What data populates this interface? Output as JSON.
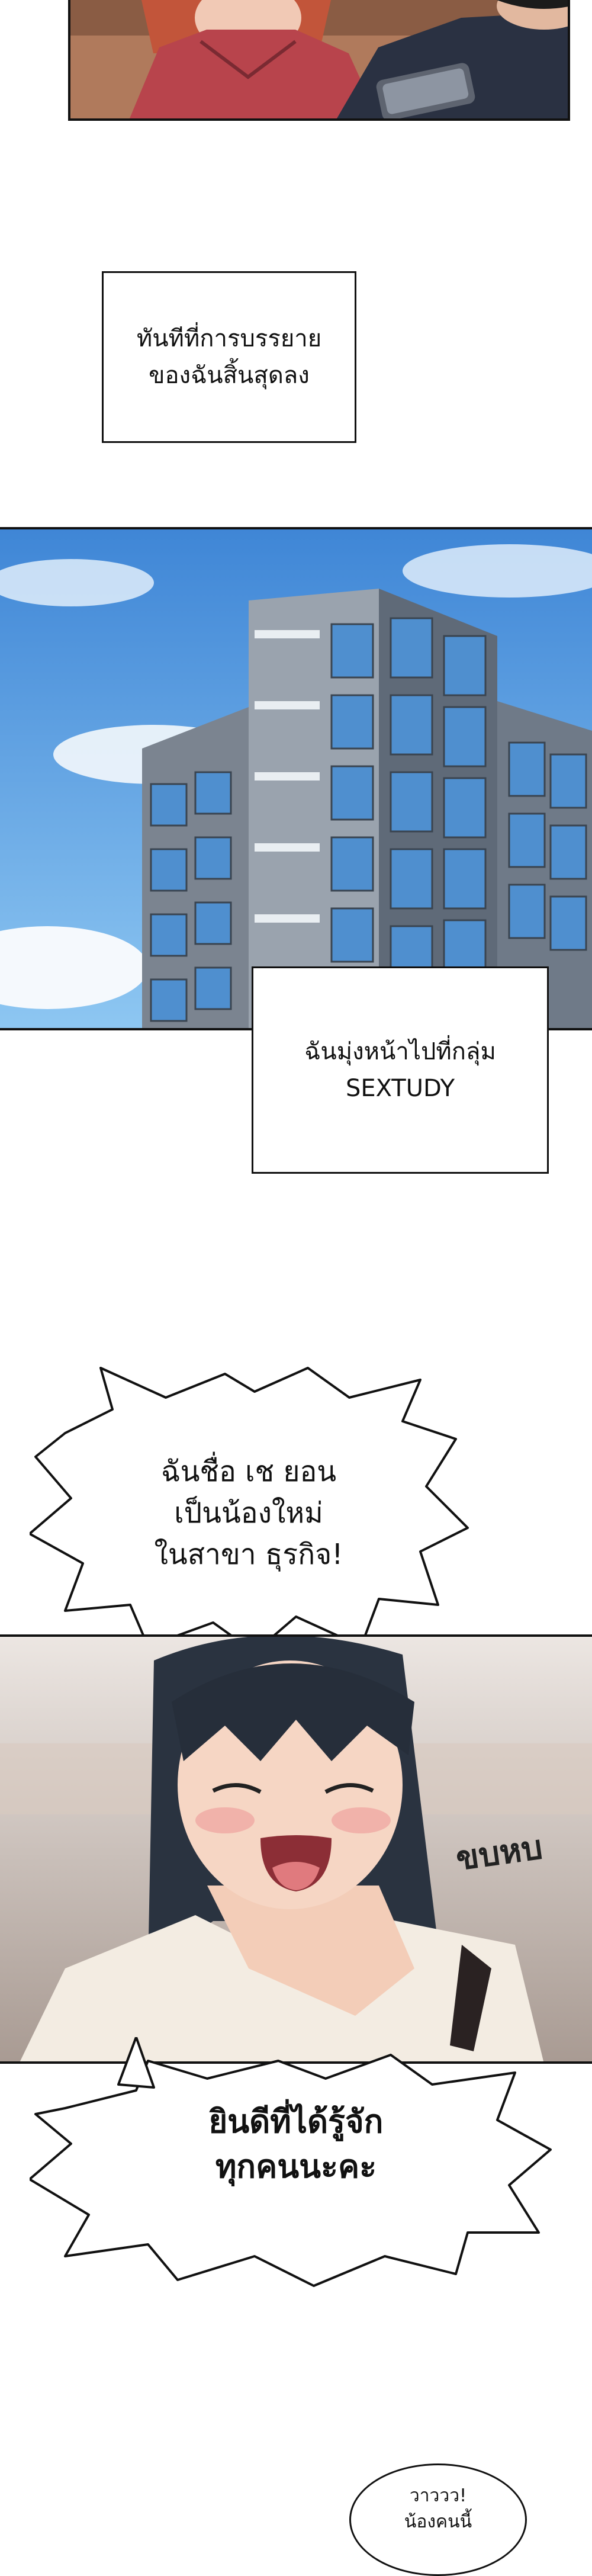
{
  "captions": {
    "narration_end": [
      "ทันทีที่การบรรยาย",
      "ของฉันสิ้นสุดลง"
    ],
    "head_to_group": [
      "ฉันมุ่งหน้าไปที่กลุ่ม",
      "SEXTUDY"
    ]
  },
  "bubbles": {
    "intro": [
      "ฉันชื่อ เช ยอน",
      "เป็นน้องใหม่",
      "ในสาขา ธุรกิจ!"
    ],
    "greeting": [
      "ยินดีที่ได้รู้จัก",
      "ทุกคนนะคะ"
    ],
    "wow": [
      "วาววว!",
      "น้องคนนี้"
    ]
  },
  "sfx": {
    "shy": "ขบหบ"
  }
}
